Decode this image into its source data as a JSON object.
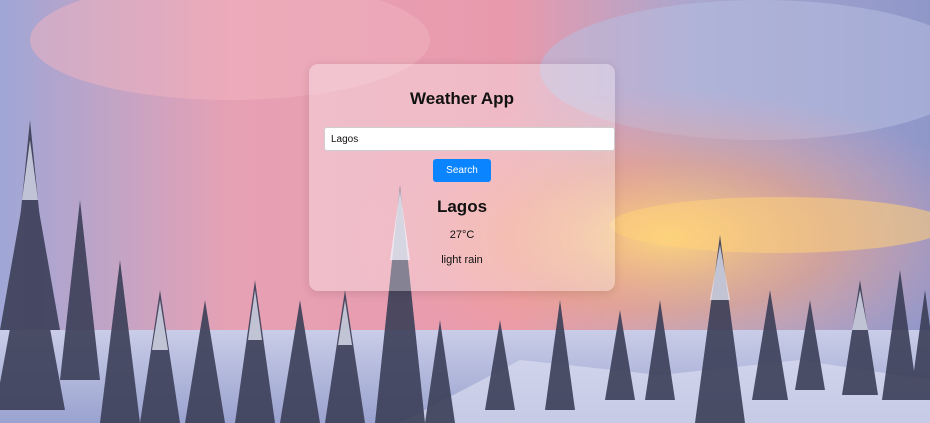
{
  "app": {
    "title": "Weather App"
  },
  "search": {
    "value": "Lagos",
    "placeholder": "",
    "button_label": "Search"
  },
  "weather": {
    "city": "Lagos",
    "temperature": "27°C",
    "description": "light rain"
  },
  "background": {
    "scene": "snowy forest at sunset",
    "colors": {
      "sky_pink": "#e89aac",
      "sky_blue": "#8f97c9",
      "sky_gold": "#f8c46a",
      "snow": "#d8dcf0",
      "trees": "#3c3f58"
    }
  },
  "theme": {
    "accent": "#0a84ff"
  }
}
